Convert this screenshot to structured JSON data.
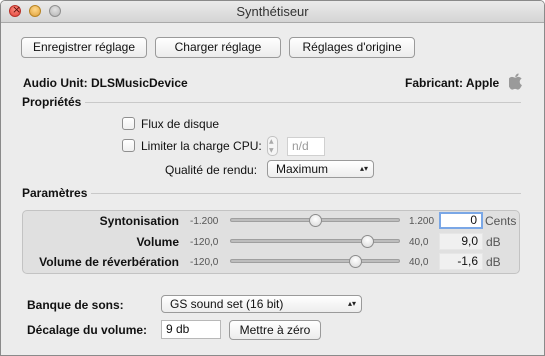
{
  "window": {
    "title": "Synthétiseur"
  },
  "toolbar": {
    "save_label": "Enregistrer réglage",
    "load_label": "Charger réglage",
    "defaults_label": "Réglages d'origine"
  },
  "info": {
    "audio_unit": "Audio Unit: DLSMusicDevice",
    "manufacturer": "Fabricant: Apple"
  },
  "properties": {
    "title": "Propriétés",
    "disk_stream_label": "Flux de disque",
    "disk_stream_checked": false,
    "cpu_limit_label": "Limiter la charge CPU:",
    "cpu_limit_checked": false,
    "cpu_limit_value": "n/d",
    "render_quality_label": "Qualité de rendu:",
    "render_quality_value": "Maximum"
  },
  "parameters": {
    "title": "Paramètres",
    "rows": [
      {
        "label": "Syntonisation",
        "min": "-1.200",
        "max": "1.200",
        "value": "0",
        "unit": "Cents",
        "level": 0.5
      },
      {
        "label": "Volume",
        "min": "-120,0",
        "max": "40,0",
        "value": "9,0",
        "unit": "dB",
        "level": 0.81
      },
      {
        "label": "Volume de réverbération",
        "min": "-120,0",
        "max": "40,0",
        "value": "-1,6",
        "unit": "dB",
        "level": 0.74
      }
    ]
  },
  "bank": {
    "label": "Banque de sons:",
    "value": "GS sound set (16 bit)"
  },
  "volume_offset": {
    "label": "Décalage du volume:",
    "value": "9 db",
    "reset_label": "Mettre à zéro"
  }
}
